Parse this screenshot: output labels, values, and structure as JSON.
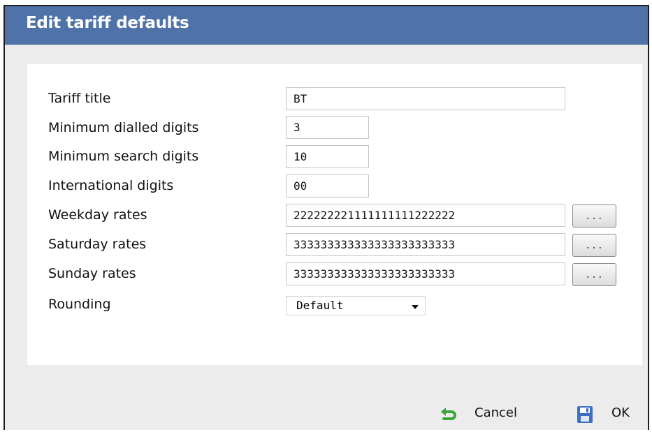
{
  "dialog": {
    "title": "Edit tariff defaults"
  },
  "form": {
    "tariff_title_label": "Tariff title",
    "tariff_title_value": "BT",
    "min_dialled_label": "Minimum dialled digits",
    "min_dialled_value": "3",
    "min_search_label": "Minimum search digits",
    "min_search_value": "10",
    "intl_digits_label": "International digits",
    "intl_digits_value": "00",
    "weekday_label": "Weekday rates",
    "weekday_value": "222222221111111111222222",
    "saturday_label": "Saturday rates",
    "saturday_value": "333333333333333333333333",
    "sunday_label": "Sunday rates",
    "sunday_value": "333333333333333333333333",
    "rounding_label": "Rounding",
    "rounding_value": "Default",
    "ellipsis_label": "..."
  },
  "footer": {
    "cancel_label": "Cancel",
    "ok_label": "OK"
  },
  "colors": {
    "titlebar": "#4f73a8",
    "cancel_icon": "#3aa63a",
    "ok_icon": "#3c6fc0"
  },
  "icons": {
    "cancel": "undo-arrow-icon",
    "ok": "floppy-disk-icon",
    "select": "chevron-down-icon"
  }
}
